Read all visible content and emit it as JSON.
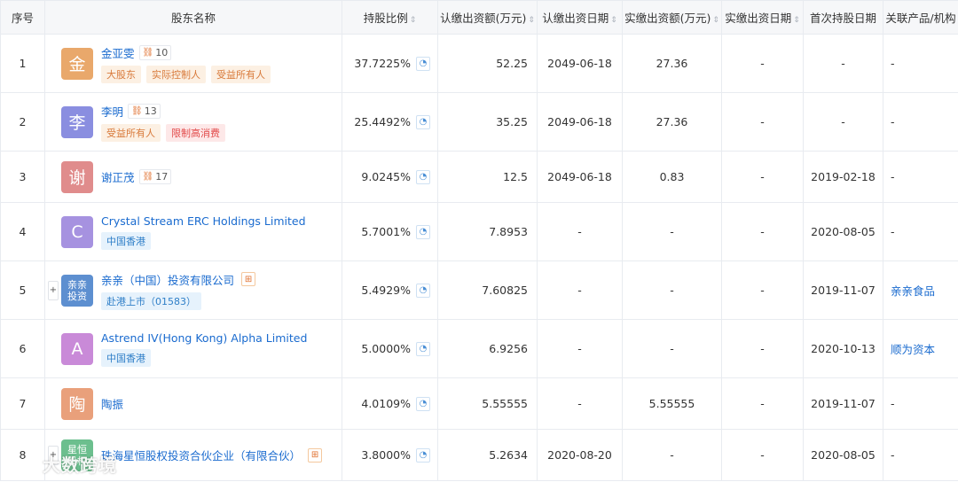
{
  "headers": {
    "index": "序号",
    "name": "股东名称",
    "ratio": "持股比例",
    "sub_amount": "认缴出资额(万元)",
    "sub_date": "认缴出资日期",
    "paid_amount": "实缴出资额(万元)",
    "paid_date": "实缴出资日期",
    "first_date": "首次持股日期",
    "related": "关联产品/机构"
  },
  "rows": [
    {
      "index": "1",
      "avatar": "金",
      "avatar_color": "#e9a86b",
      "name": "金亚雯",
      "badge": "10",
      "tags": [
        {
          "text": "大股东",
          "style": "orange"
        },
        {
          "text": "实际控制人",
          "style": "orange"
        },
        {
          "text": "受益所有人",
          "style": "orange"
        }
      ],
      "ratio": "37.7225%",
      "sub_amount": "52.25",
      "sub_date": "2049-06-18",
      "paid_amount": "27.36",
      "paid_date": "-",
      "first_date": "-",
      "related": "-"
    },
    {
      "index": "2",
      "avatar": "李",
      "avatar_color": "#8a8ee0",
      "name": "李明",
      "badge": "13",
      "tags": [
        {
          "text": "受益所有人",
          "style": "orange"
        },
        {
          "text": "限制高消费",
          "style": "red"
        }
      ],
      "ratio": "25.4492%",
      "sub_amount": "35.25",
      "sub_date": "2049-06-18",
      "paid_amount": "27.36",
      "paid_date": "-",
      "first_date": "-",
      "related": "-"
    },
    {
      "index": "3",
      "avatar": "谢",
      "avatar_color": "#e08c8c",
      "name": "谢正茂",
      "badge": "17",
      "tags": [],
      "ratio": "9.0245%",
      "sub_amount": "12.5",
      "sub_date": "2049-06-18",
      "paid_amount": "0.83",
      "paid_date": "-",
      "first_date": "2019-02-18",
      "related": "-"
    },
    {
      "index": "4",
      "avatar": "C",
      "avatar_color": "#a692e0",
      "name": "Crystal Stream ERC Holdings Limited",
      "badge": "",
      "tags": [
        {
          "text": "中国香港",
          "style": "blue"
        }
      ],
      "ratio": "5.7001%",
      "sub_amount": "7.8953",
      "sub_date": "-",
      "paid_amount": "-",
      "paid_date": "-",
      "first_date": "2020-08-05",
      "related": "-"
    },
    {
      "index": "5",
      "avatar": "亲亲投资",
      "avatar_color": "#5d8fd0",
      "name": "亲亲（中国）投资有限公司",
      "badge": "",
      "tree": true,
      "expand": true,
      "tags": [
        {
          "text": "赴港上市（01583）",
          "style": "blue"
        }
      ],
      "ratio": "5.4929%",
      "sub_amount": "7.60825",
      "sub_date": "-",
      "paid_amount": "-",
      "paid_date": "-",
      "first_date": "2019-11-07",
      "related": "亲亲食品"
    },
    {
      "index": "6",
      "avatar": "A",
      "avatar_color": "#c98ad8",
      "name": "Astrend IV(Hong Kong) Alpha Limited",
      "badge": "",
      "tags": [
        {
          "text": "中国香港",
          "style": "blue"
        }
      ],
      "ratio": "5.0000%",
      "sub_amount": "6.9256",
      "sub_date": "-",
      "paid_amount": "-",
      "paid_date": "-",
      "first_date": "2020-10-13",
      "related": "顺为资本"
    },
    {
      "index": "7",
      "avatar": "陶",
      "avatar_color": "#e9a07b",
      "name": "陶振",
      "badge": "",
      "tags": [],
      "ratio": "4.0109%",
      "sub_amount": "5.55555",
      "sub_date": "-",
      "paid_amount": "5.55555",
      "paid_date": "-",
      "first_date": "2019-11-07",
      "related": "-"
    },
    {
      "index": "8",
      "avatar": "星恒股权",
      "avatar_color": "#6cbf8e",
      "name": "珠海星恒股权投资合伙企业（有限合伙）",
      "badge": "",
      "tree": true,
      "expand": true,
      "tags": [],
      "ratio": "3.8000%",
      "sub_amount": "5.2634",
      "sub_date": "2020-08-20",
      "paid_amount": "-",
      "paid_date": "-",
      "first_date": "2020-08-05",
      "related": "-"
    }
  ],
  "watermark": "大数跨境",
  "colors": {
    "link": "#1a6bcf",
    "header_bg": "#f6f7f9"
  }
}
